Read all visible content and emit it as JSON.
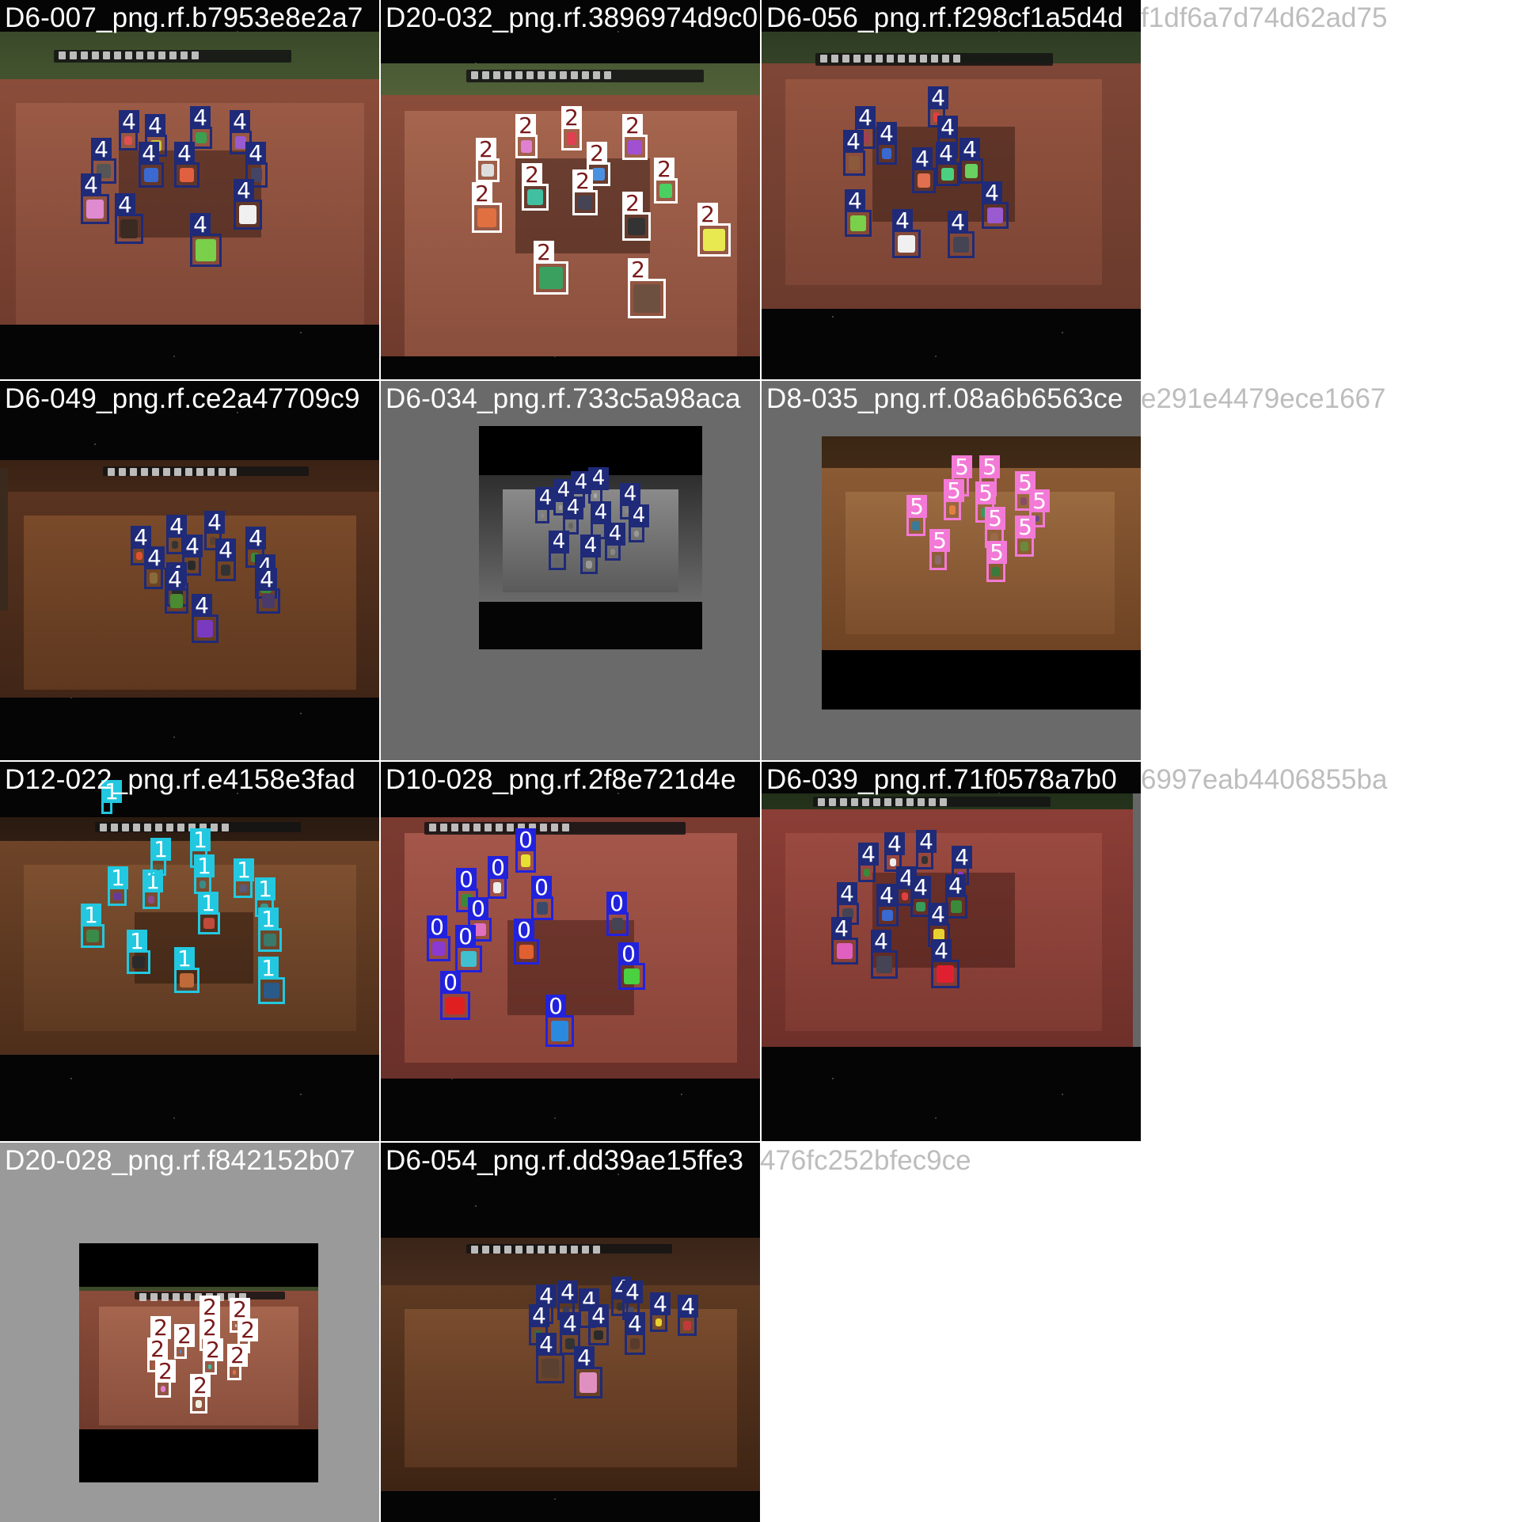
{
  "tiles": [
    {
      "title": "D6-007_png.rf.b7953e8e2a7",
      "label": "4"
    },
    {
      "title": "D20-032_png.rf.3896974d9c0",
      "label": "2"
    },
    {
      "title": "D6-056_png.rf.f298cf1a5d4d",
      "label": "4"
    },
    {
      "title": "D6-049_png.rf.ce2a47709c9",
      "label": "4"
    },
    {
      "title": "D6-034_png.rf.733c5a98aca",
      "label": "4"
    },
    {
      "title": "D8-035_png.rf.08a6b6563ce",
      "label": "5"
    },
    {
      "title": "D12-022_png.rf.e4158e3fad",
      "label": "1"
    },
    {
      "title": "D10-028_png.rf.2f8e721d4e",
      "label": "0"
    },
    {
      "title": "D6-039_png.rf.71f0578a7b0",
      "label": "4"
    },
    {
      "title": "D20-028_png.rf.f842152b07",
      "label": "2"
    },
    {
      "title": "D6-054_png.rf.dd39ae15ffe3",
      "label": "4"
    }
  ],
  "overflow_titles": [
    "f1df6a7d74d62ad75",
    "e291e4479ece1667",
    "6997eab4406855ba",
    "476fc252bfec9ce"
  ],
  "colors": {
    "d6_box": "#1f2a78",
    "d20_box": "#ffffff",
    "d20_label": "#7a1a1a",
    "d8_box": "#f27ad6",
    "d12_box": "#22c8e0",
    "d10_box": "#2222dd"
  }
}
